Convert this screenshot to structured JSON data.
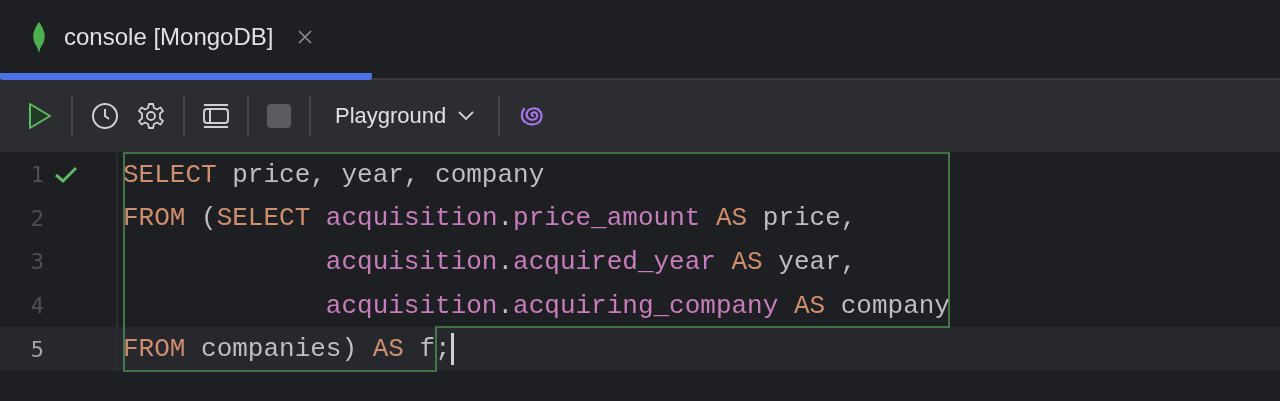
{
  "tabs": [
    {
      "label": "console [MongoDB]",
      "selected": true
    }
  ],
  "toolbar": {
    "stop": {
      "disabled": true
    },
    "schema": {
      "label": "Playground"
    }
  },
  "editor": {
    "lines": [
      {
        "number": "1",
        "executed": true,
        "current": false,
        "cursor": false,
        "tokens": [
          {
            "kind": "keyword",
            "text": "SELECT"
          },
          {
            "kind": "plain",
            "text": " price, year, company"
          }
        ]
      },
      {
        "number": "2",
        "executed": false,
        "current": false,
        "cursor": false,
        "tokens": [
          {
            "kind": "keyword",
            "text": "FROM"
          },
          {
            "kind": "plain",
            "text": " ("
          },
          {
            "kind": "keyword",
            "text": "SELECT"
          },
          {
            "kind": "field",
            "text": " acquisition"
          },
          {
            "kind": "plain",
            "text": "."
          },
          {
            "kind": "field",
            "text": "price_amount "
          },
          {
            "kind": "keyword",
            "text": "AS"
          },
          {
            "kind": "plain",
            "text": " price,"
          }
        ]
      },
      {
        "number": "3",
        "executed": false,
        "current": false,
        "cursor": false,
        "tokens": [
          {
            "kind": "field",
            "text": "             acquisition"
          },
          {
            "kind": "plain",
            "text": "."
          },
          {
            "kind": "field",
            "text": "acquired_year "
          },
          {
            "kind": "keyword",
            "text": "AS"
          },
          {
            "kind": "plain",
            "text": " year,"
          }
        ]
      },
      {
        "number": "4",
        "executed": false,
        "current": false,
        "cursor": false,
        "tokens": [
          {
            "kind": "field",
            "text": "             acquisition"
          },
          {
            "kind": "plain",
            "text": "."
          },
          {
            "kind": "field",
            "text": "acquiring_company "
          },
          {
            "kind": "keyword",
            "text": "AS"
          },
          {
            "kind": "plain",
            "text": " company"
          }
        ]
      },
      {
        "number": "5",
        "executed": false,
        "current": true,
        "cursor": true,
        "tokens": [
          {
            "kind": "keyword",
            "text": "FROM"
          },
          {
            "kind": "plain",
            "text": " companies) "
          },
          {
            "kind": "keyword",
            "text": "AS"
          },
          {
            "kind": "plain",
            "text": " f;"
          }
        ]
      }
    ]
  }
}
